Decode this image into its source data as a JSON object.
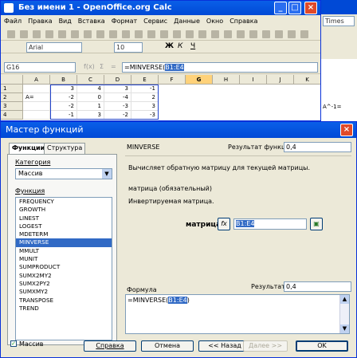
{
  "calc": {
    "title": "Без имени 1 - OpenOffice.org Calc",
    "menu": [
      "Файл",
      "Правка",
      "Вид",
      "Вставка",
      "Формат",
      "Сервис",
      "Данные",
      "Окно",
      "Справка"
    ],
    "font_name": "Arial",
    "font_size": "10",
    "name_box": "G16",
    "formula": "=MINVERSE(",
    "formula_sel": "B1:E4",
    "columns": [
      "A",
      "B",
      "C",
      "D",
      "E",
      "F",
      "G",
      "H",
      "I",
      "J",
      "K"
    ],
    "rows": [
      {
        "n": "1",
        "a": "",
        "cells": [
          "3",
          "4",
          "3",
          "-1"
        ]
      },
      {
        "n": "2",
        "a": "A=",
        "cells": [
          "-2",
          "0",
          "-4",
          "2"
        ]
      },
      {
        "n": "3",
        "a": "",
        "cells": [
          "-2",
          "1",
          "-3",
          "3"
        ]
      },
      {
        "n": "4",
        "a": "",
        "cells": [
          "-1",
          "3",
          "-2",
          "-3"
        ]
      }
    ]
  },
  "bg": {
    "font": "Times",
    "cell_text": "A^-1="
  },
  "dialog": {
    "title": "Мастер функций",
    "tabs": [
      "Функции",
      "Структура"
    ],
    "category_label": "Категория",
    "category_value": "Массив",
    "function_label": "Функция",
    "functions": [
      "FREQUENCY",
      "GROWTH",
      "LINEST",
      "LOGEST",
      "MDETERM",
      "MINVERSE",
      "MMULT",
      "MUNIT",
      "SUMPRODUCT",
      "SUMX2MY2",
      "SUMX2PY2",
      "SUMXMY2",
      "TRANSPOSE",
      "TREND"
    ],
    "selected_function": "MINVERSE",
    "fn_name": "MINVERSE",
    "result_label": "Результат функции",
    "result_value": "0,4",
    "description": "Вычисляет обратную матрицу для текущей матрицы.",
    "arg_required": "матрица (обязательный)",
    "arg_desc": "Инвертируемая матрица.",
    "arg_label": "матрица",
    "fx": "fx",
    "arg_value": "B1:E4",
    "formula_label": "Формула",
    "formula_result_label": "Результат",
    "formula_result": "0,4",
    "formula_text": "=MINVERSE(",
    "formula_sel": "B1:E4",
    "formula_close": ")",
    "array_checkbox": "Массив",
    "buttons": {
      "help": "Справка",
      "cancel": "Отмена",
      "back": "<< Назад",
      "next": "Далее >>",
      "ok": "OK"
    }
  }
}
